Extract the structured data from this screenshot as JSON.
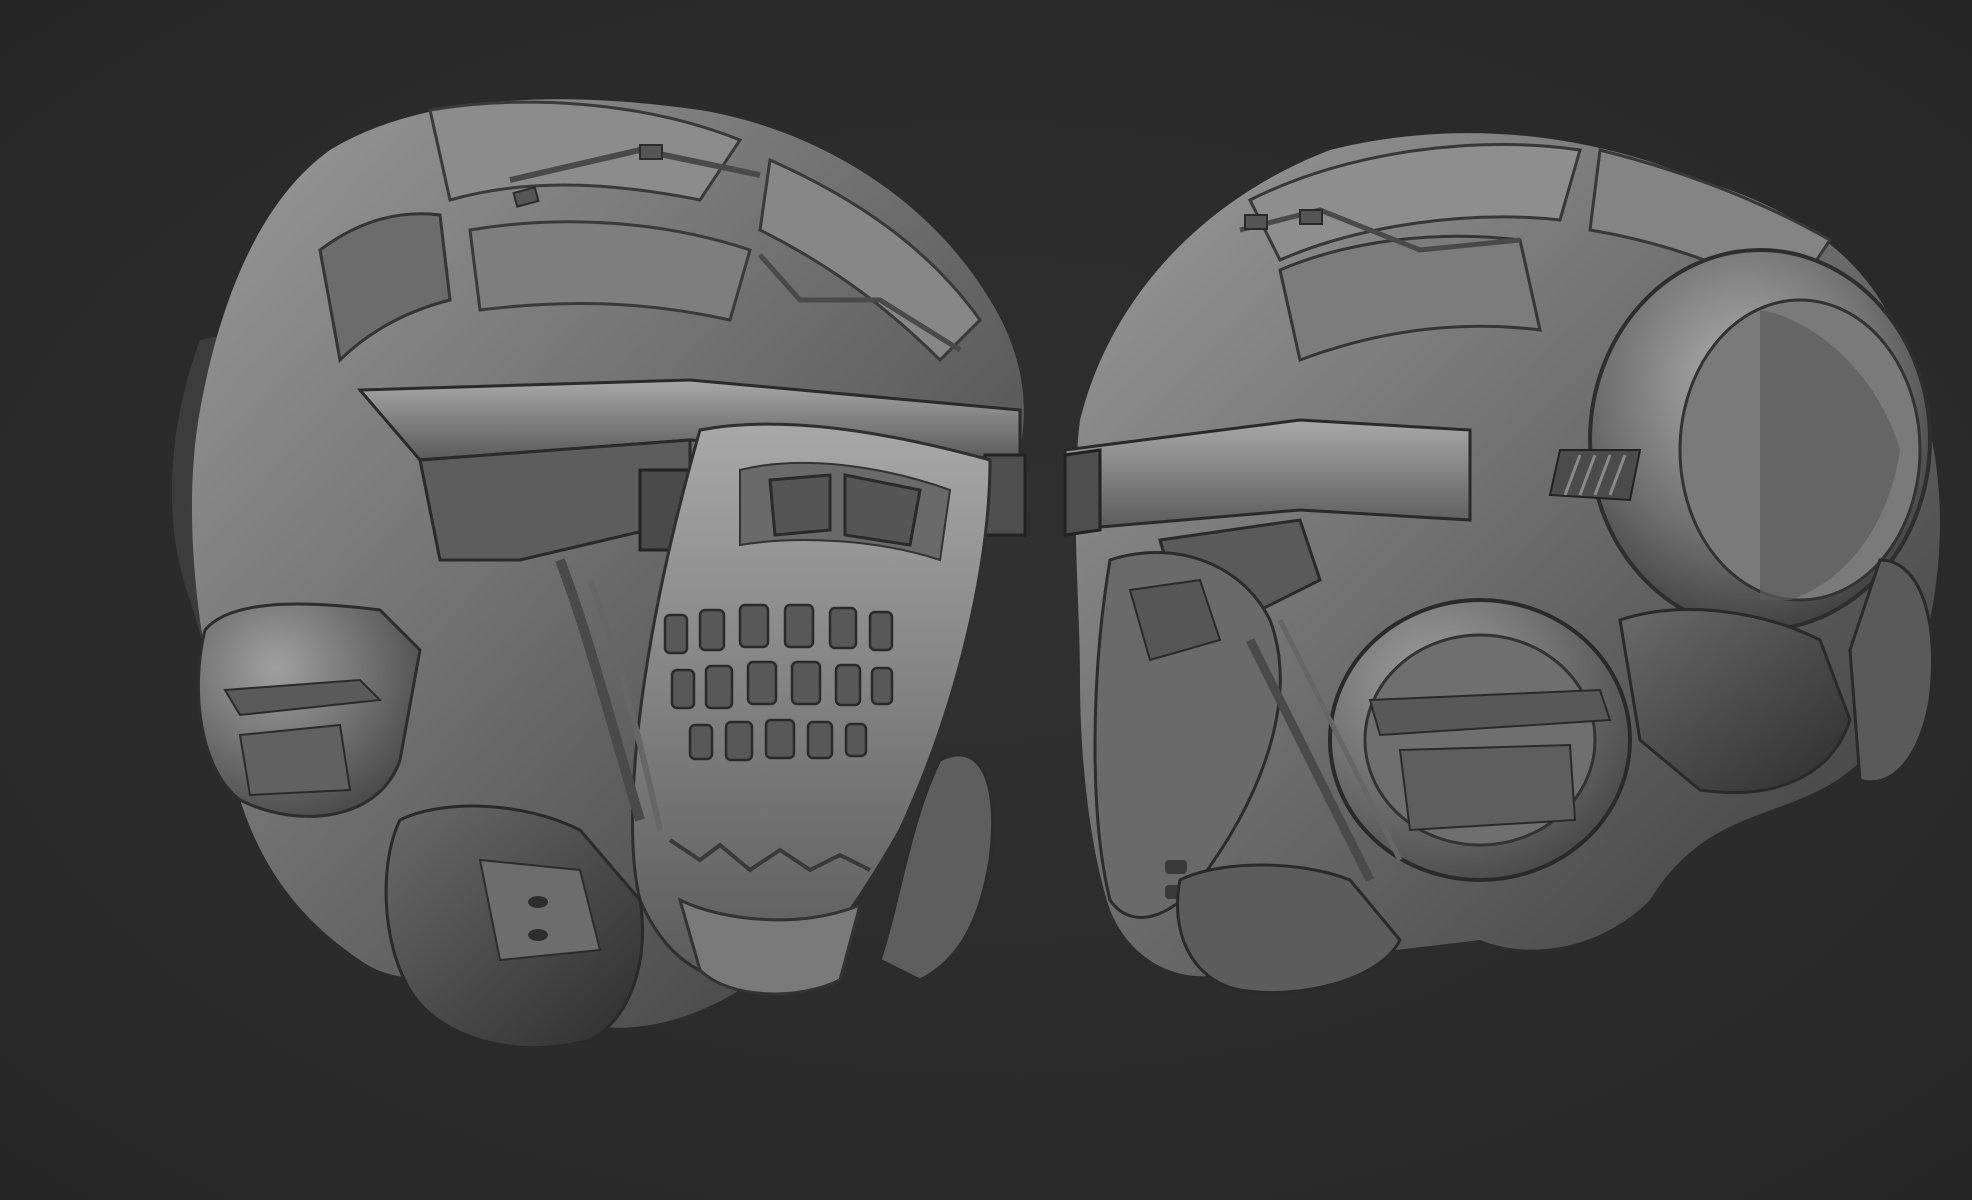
{
  "scene": {
    "background_color": "#2c2c2c",
    "material_base_color": "#6e6e6e",
    "material_highlight_color": "#b4b4b4",
    "material_shadow_color": "#2a2a2a",
    "objects": [
      {
        "kind": "helmet-render",
        "view": "front-three-quarter"
      },
      {
        "kind": "helmet-render",
        "view": "side-profile"
      }
    ]
  }
}
